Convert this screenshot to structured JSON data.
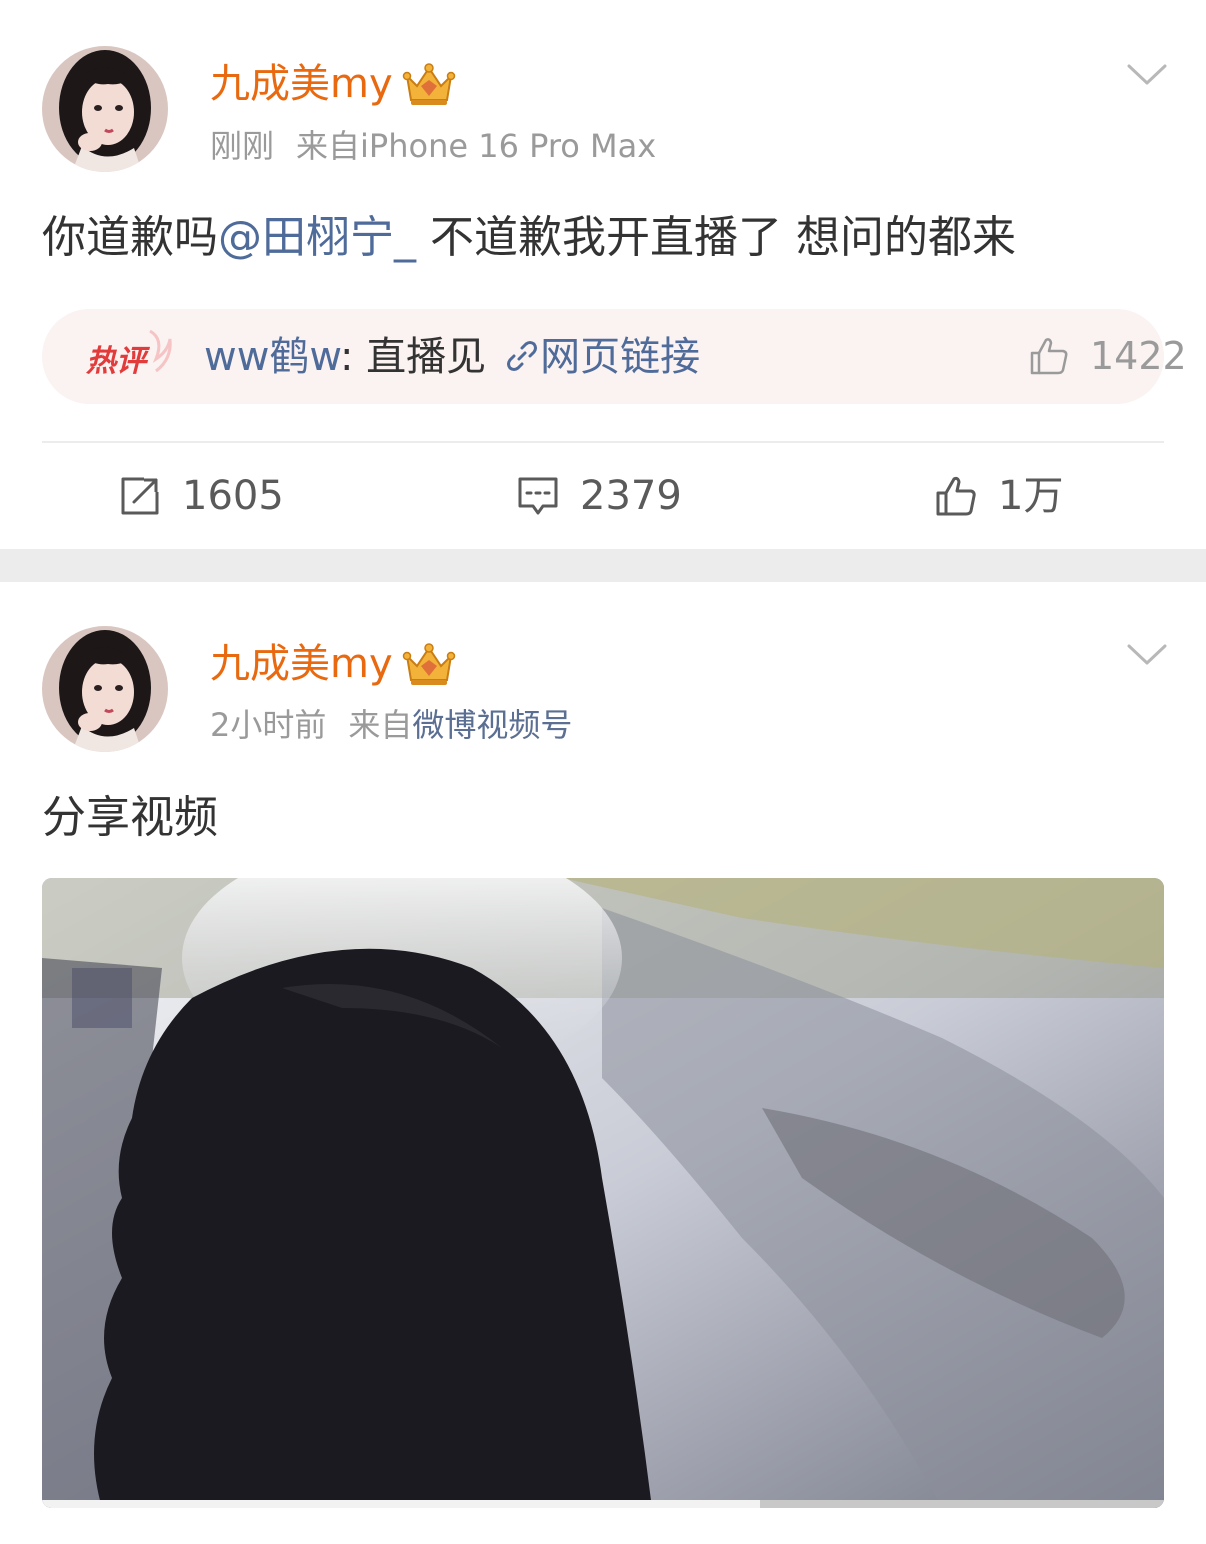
{
  "posts": [
    {
      "username": "九成美my",
      "time": "刚刚",
      "source_prefix": "来自",
      "source": "iPhone 16 Pro Max",
      "content_before": "你道歉吗",
      "mention": "@田栩宁_",
      "content_after": " 不道歉我开直播了 想问的都来",
      "hot_comment": {
        "badge": "热评",
        "user": "ww鹤w",
        "separator": ": ",
        "text": "直播见",
        "link_label": "网页链接",
        "like_count": "1422"
      },
      "repost_count": "1605",
      "comment_count": "2379",
      "like_count": "1万"
    },
    {
      "username": "九成美my",
      "time": "2小时前",
      "source_prefix": "来自",
      "source": "微博视频号",
      "content": "分享视频",
      "video": {
        "progress_fraction": 0.64
      }
    }
  ],
  "colors": {
    "username": "#e8690f",
    "link": "#4f6b99",
    "meta": "#9a9a9a",
    "hot_bg": "#fbf2f2",
    "hot_badge": "#e23b3b",
    "separator_band": "#ececec"
  },
  "icons": {
    "vip": "crown-badge-icon",
    "more": "chevron-down-icon",
    "repost": "repost-icon",
    "comment": "comment-icon",
    "like": "thumbs-up-icon",
    "link": "link-icon"
  }
}
